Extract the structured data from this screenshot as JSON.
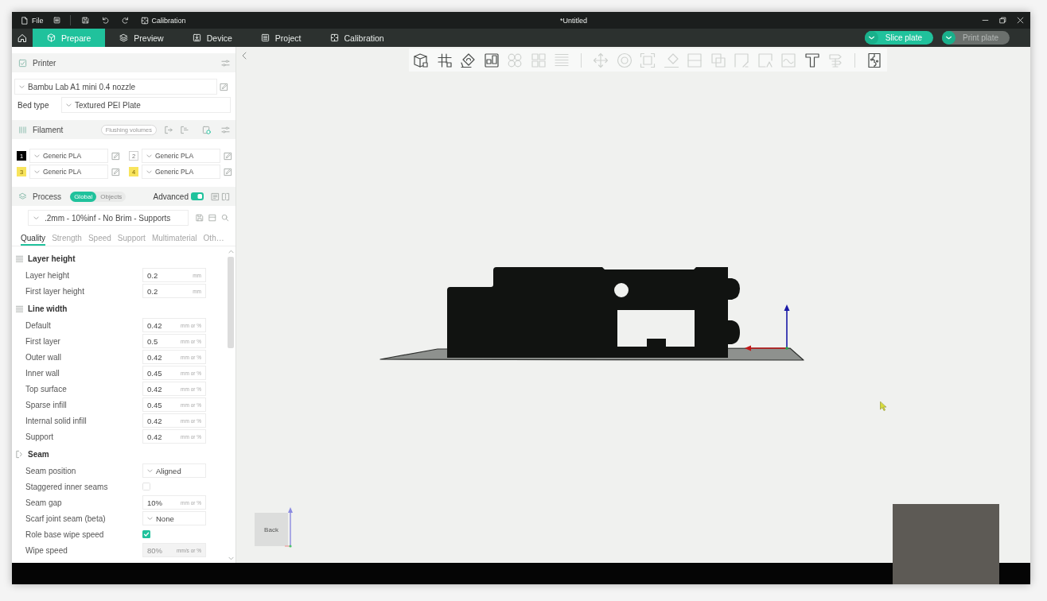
{
  "title_bar": {
    "file_menu": "File",
    "calibration_button": "Calibration",
    "title": "*Untitled"
  },
  "tabs": [
    {
      "label": "Prepare",
      "selected": true
    },
    {
      "label": "Preview",
      "selected": false
    },
    {
      "label": "Device",
      "selected": false
    },
    {
      "label": "Project",
      "selected": false
    },
    {
      "label": "Calibration",
      "selected": false
    }
  ],
  "actions": [
    {
      "label": "Slice plate",
      "disabled": false
    },
    {
      "label": "Print plate",
      "disabled": true
    }
  ],
  "sidebar": {
    "printer": {
      "title": "Printer",
      "preset": "Bambu Lab A1 mini 0.4 nozzle",
      "bed_type_label": "Bed type",
      "bed_type": "Textured PEI Plate"
    },
    "filament": {
      "title": "Filament",
      "flushing_button": "Flushing volumes",
      "slots": [
        {
          "number": "1",
          "color": "#000000",
          "material": "Generic PLA"
        },
        {
          "number": "2",
          "color": "#ffffff",
          "material": "Generic PLA"
        },
        {
          "number": "3",
          "color": "#f8e45c",
          "material": "Generic PLA"
        },
        {
          "number": "4",
          "color": "#f8e45c",
          "material": "Generic PLA"
        }
      ]
    },
    "process": {
      "title": "Process",
      "scope": [
        {
          "label": "Global",
          "selected": true
        },
        {
          "label": "Objects",
          "selected": false
        }
      ],
      "advanced_label": "Advanced",
      "advanced": true,
      "preset": ".2mm - 10%inf - No Brim - Supports"
    },
    "tabs": [
      {
        "label": "Quality",
        "selected": true
      },
      {
        "label": "Strength",
        "selected": false
      },
      {
        "label": "Speed",
        "selected": false
      },
      {
        "label": "Support",
        "selected": false
      },
      {
        "label": "Multimaterial",
        "selected": false
      },
      {
        "label": "Oth…",
        "selected": false
      }
    ],
    "groups": [
      {
        "title": "Layer height",
        "options": [
          {
            "kind": "number",
            "label": "Layer height",
            "value": "0.2",
            "unit": "mm",
            "disabled": false
          },
          {
            "kind": "number",
            "label": "First layer height",
            "value": "0.2",
            "unit": "mm",
            "disabled": false
          }
        ]
      },
      {
        "title": "Line width",
        "options": [
          {
            "kind": "number",
            "label": "Default",
            "value": "0.42",
            "unit": "mm or %",
            "disabled": false
          },
          {
            "kind": "number",
            "label": "First layer",
            "value": "0.5",
            "unit": "mm or %",
            "disabled": false
          },
          {
            "kind": "number",
            "label": "Outer wall",
            "value": "0.42",
            "unit": "mm or %",
            "disabled": false
          },
          {
            "kind": "number",
            "label": "Inner wall",
            "value": "0.45",
            "unit": "mm or %",
            "disabled": false
          },
          {
            "kind": "number",
            "label": "Top surface",
            "value": "0.42",
            "unit": "mm or %",
            "disabled": false
          },
          {
            "kind": "number",
            "label": "Sparse infill",
            "value": "0.45",
            "unit": "mm or %",
            "disabled": false
          },
          {
            "kind": "number",
            "label": "Internal solid infill",
            "value": "0.42",
            "unit": "mm or %",
            "disabled": false
          },
          {
            "kind": "number",
            "label": "Support",
            "value": "0.42",
            "unit": "mm or %",
            "disabled": false
          }
        ]
      },
      {
        "title": "Seam",
        "options": [
          {
            "kind": "select",
            "label": "Seam position",
            "value": "Aligned",
            "disabled": false
          },
          {
            "kind": "checkbox",
            "label": "Staggered inner seams",
            "checked": false,
            "disabled": false
          },
          {
            "kind": "number",
            "label": "Seam gap",
            "value": "10%",
            "unit": "mm or %",
            "disabled": false
          },
          {
            "kind": "select",
            "label": "Scarf joint seam (beta)",
            "value": "None",
            "disabled": false
          },
          {
            "kind": "checkbox",
            "label": "Role base wipe speed",
            "checked": true,
            "disabled": false
          },
          {
            "kind": "number",
            "label": "Wipe speed",
            "value": "80%",
            "unit": "mm/s or %",
            "disabled": true
          }
        ]
      }
    ]
  },
  "viewport": {
    "toolbar": [
      {
        "tools": [
          {
            "disabled": false
          },
          {
            "disabled": false
          },
          {
            "disabled": false
          },
          {
            "disabled": false
          },
          {
            "disabled": true
          },
          {
            "disabled": true
          },
          {
            "disabled": true
          }
        ]
      },
      {
        "tools": [
          {
            "disabled": true
          },
          {
            "disabled": true
          },
          {
            "disabled": true
          },
          {
            "disabled": true
          },
          {
            "disabled": true
          },
          {
            "disabled": true
          },
          {
            "disabled": true
          },
          {
            "disabled": true
          },
          {
            "disabled": true
          },
          {
            "disabled": false
          },
          {
            "disabled": true
          }
        ]
      },
      {
        "tools": [
          {
            "disabled": false
          }
        ]
      }
    ],
    "view_cube": "Back"
  }
}
